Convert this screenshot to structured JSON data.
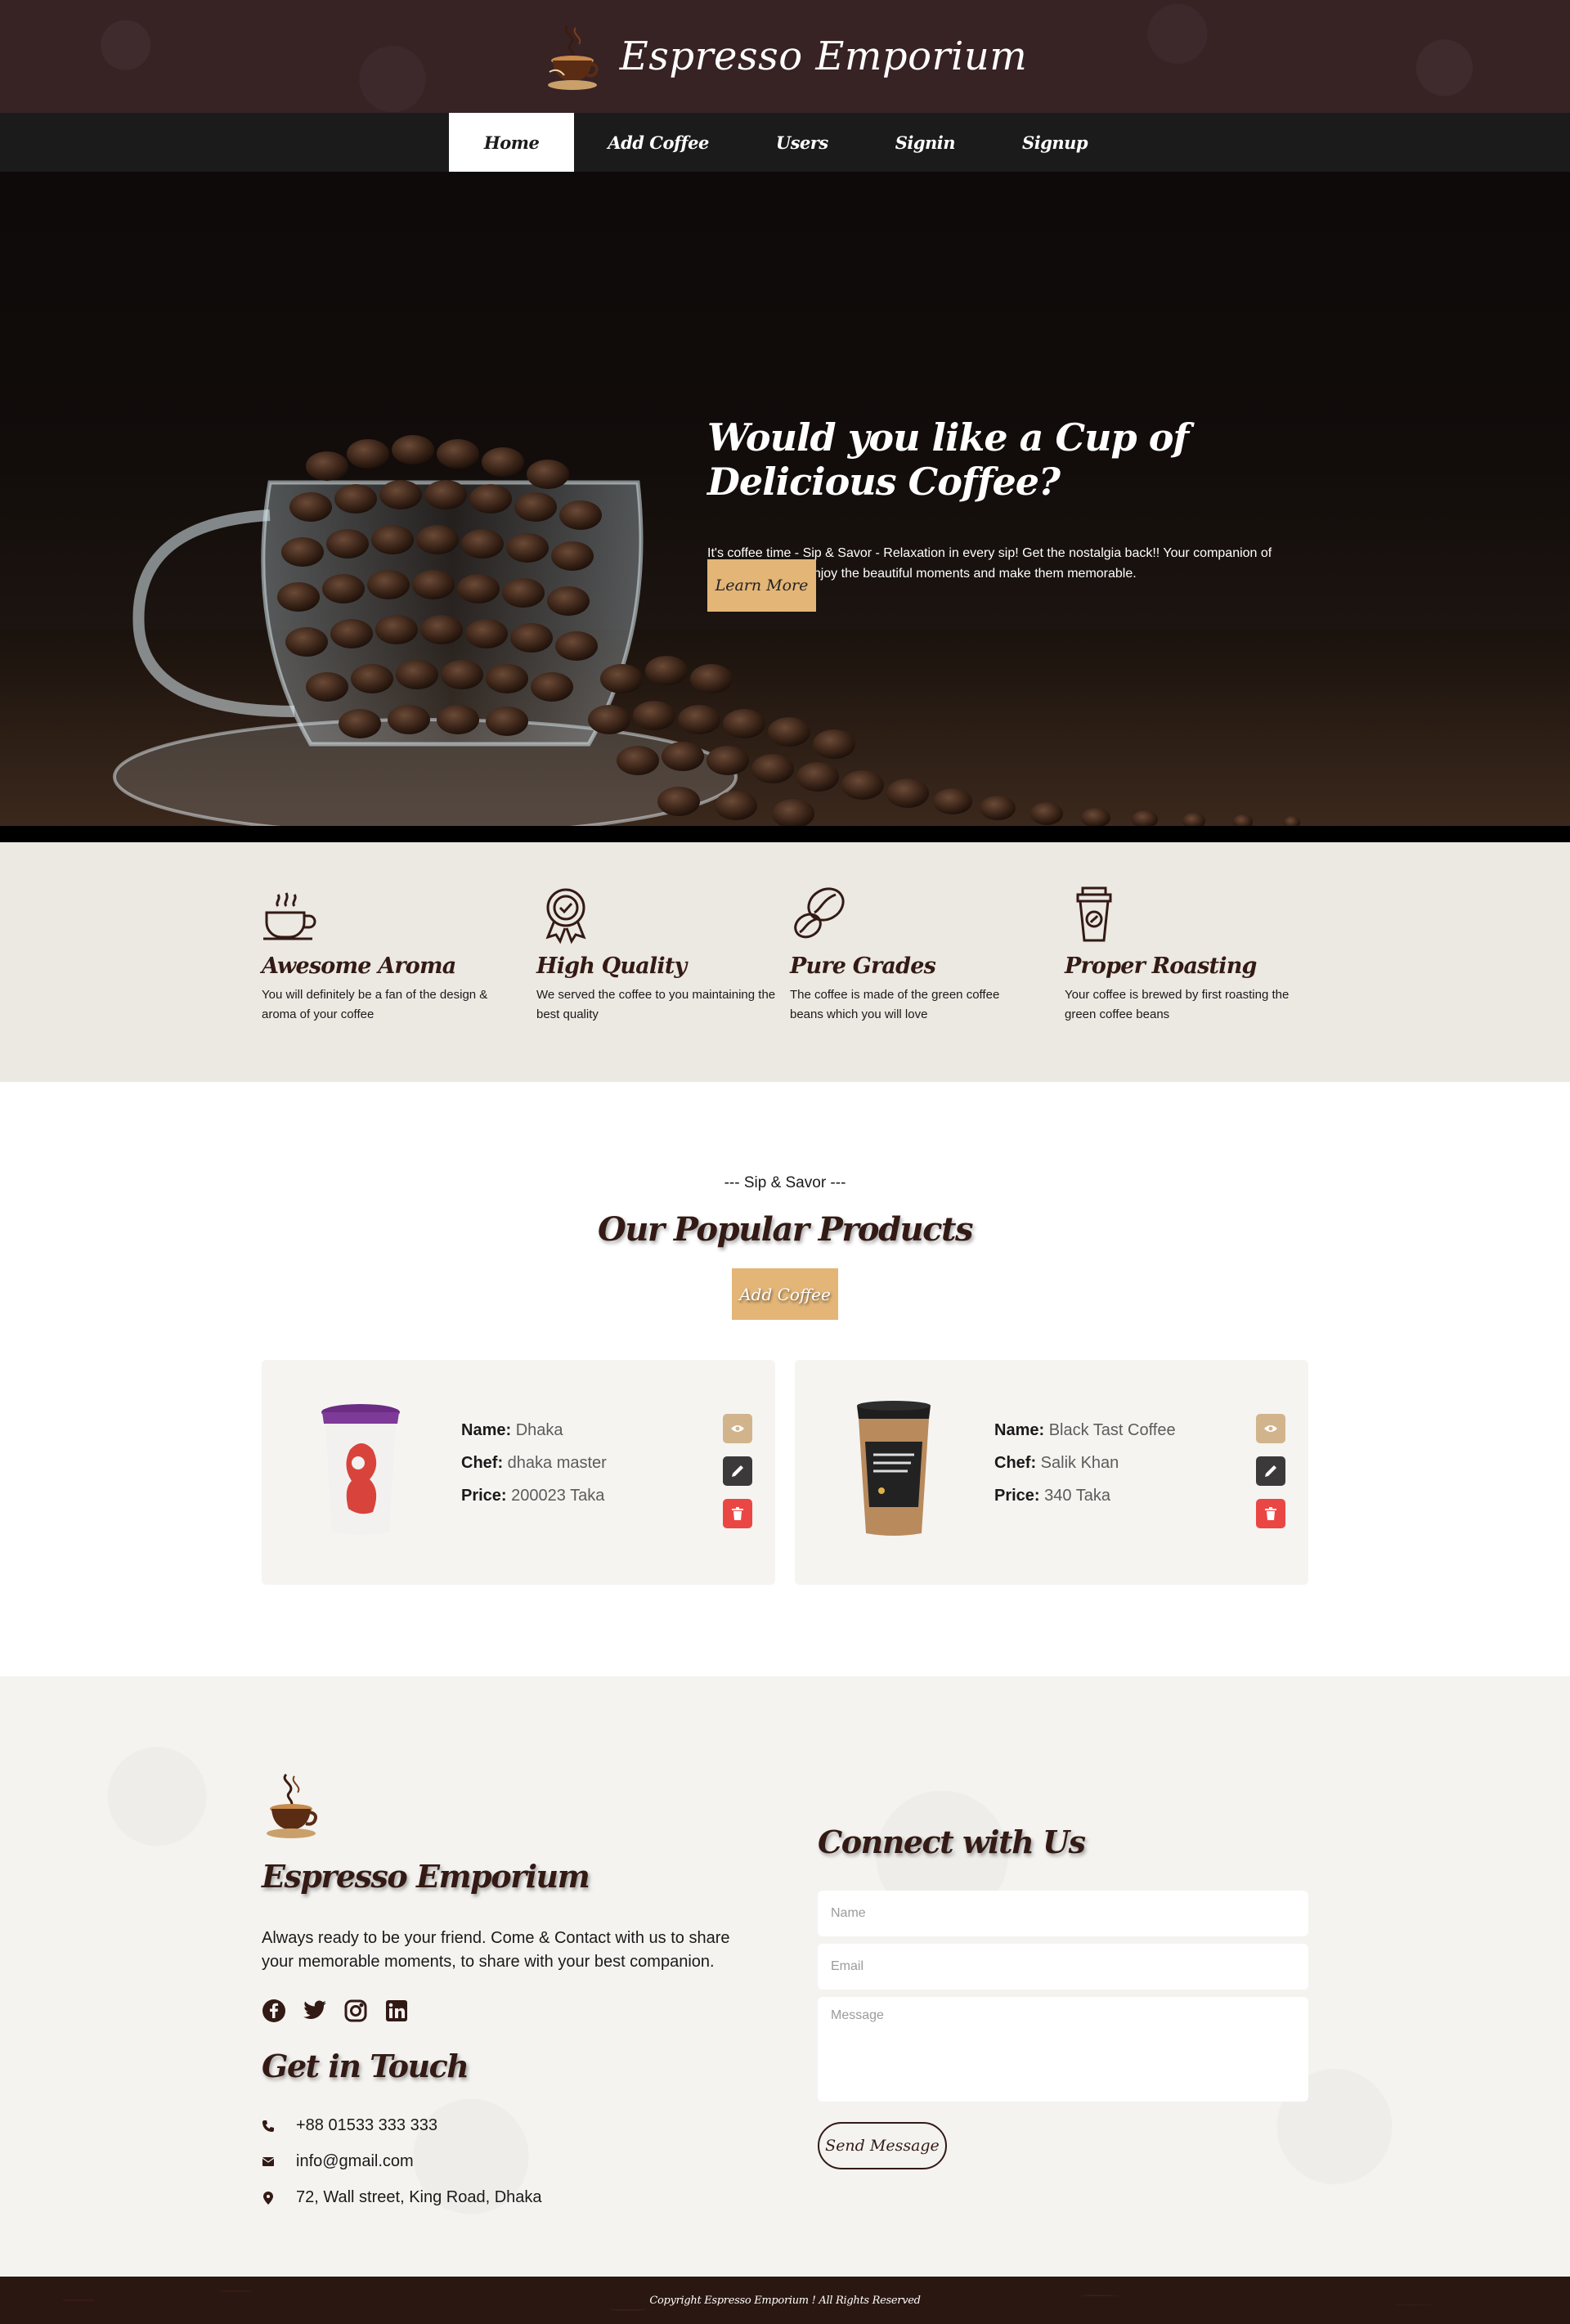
{
  "header": {
    "brand": "Espresso Emporium",
    "logo_icon": "coffee-cup-logo-icon"
  },
  "nav": {
    "items": [
      {
        "label": "Home",
        "active": true
      },
      {
        "label": "Add Coffee",
        "active": false
      },
      {
        "label": "Users",
        "active": false
      },
      {
        "label": "Signin",
        "active": false
      },
      {
        "label": "Signup",
        "active": false
      }
    ]
  },
  "hero": {
    "title": "Would you like a Cup of Delicious Coffee?",
    "text": "It's coffee time - Sip & Savor - Relaxation in every sip! Get the nostalgia back!! Your companion of every moment!!! Enjoy the beautiful moments and make them memorable.",
    "button": "Learn More"
  },
  "features": [
    {
      "icon": "hot-coffee-cup-icon",
      "title": "Awesome Aroma",
      "text": "You will definitely be a fan of the design & aroma of your coffee"
    },
    {
      "icon": "quality-badge-icon",
      "title": "High Quality",
      "text": "We served the coffee to you maintaining the best quality"
    },
    {
      "icon": "coffee-beans-icon",
      "title": "Pure Grades",
      "text": "The coffee is made of the green coffee beans which you will love"
    },
    {
      "icon": "takeaway-cup-icon",
      "title": "Proper Roasting",
      "text": "Your coffee is brewed by first roasting the green coffee beans"
    }
  ],
  "products": {
    "subtitle": "--- Sip & Savor ---",
    "title": "Our Popular Products",
    "add_button": "Add Coffee",
    "labels": {
      "name": "Name:",
      "chef": "Chef:",
      "price": "Price:"
    },
    "items": [
      {
        "name": "Dhaka",
        "chef": "dhaka master",
        "price": "200023 Taka"
      },
      {
        "name": "Black Tast Coffee",
        "chef": "Salik Khan",
        "price": "340 Taka"
      }
    ]
  },
  "footer": {
    "brand": "Espresso Emporium",
    "description": "Always ready to be your friend. Come & Contact with us to share your memorable moments, to share with your best companion.",
    "social": [
      "facebook-icon",
      "twitter-icon",
      "instagram-icon",
      "linkedin-icon"
    ],
    "get_in_touch": "Get in Touch",
    "phone": "+88 01533 333 333",
    "email": "info@gmail.com",
    "address": "72, Wall street, King Road, Dhaka",
    "connect": "Connect with Us",
    "form": {
      "name_placeholder": "Name",
      "email_placeholder": "Email",
      "message_placeholder": "Message",
      "send_button": "Send Message"
    },
    "copyright": "Copyright Espresso Emporium ! All Rights Reserved"
  },
  "colors": {
    "header_bg": "#372224",
    "nav_bg": "#1b1b1b",
    "accent": "#e3b577",
    "feature_bg": "#ece8e2",
    "text_dark": "#331a15",
    "delete": "#ea4744"
  }
}
